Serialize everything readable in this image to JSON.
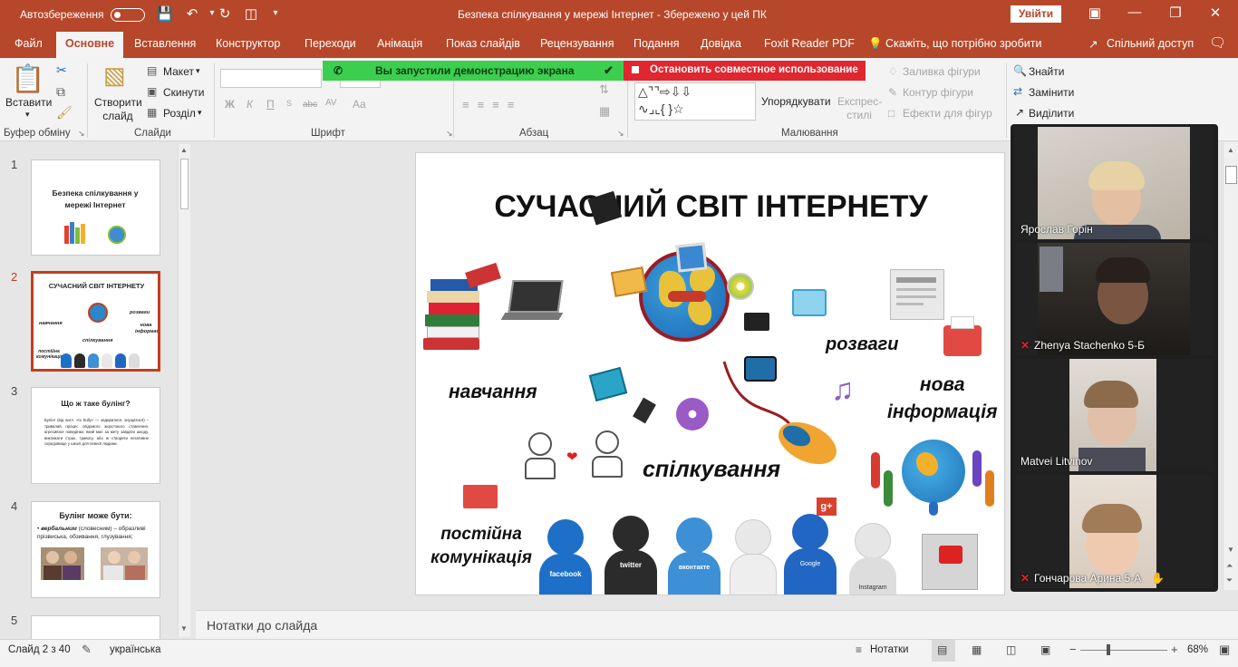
{
  "window": {
    "autosave_label": "Автозбереження",
    "autosave_state": "off",
    "doc_title": "Безпека спілкування у мережі Інтернет  -  Збережено у цей ПК",
    "signin_label": "Увійти",
    "accent_color": "#b7472a"
  },
  "tabs": [
    {
      "label": "Файл"
    },
    {
      "label": "Основне"
    },
    {
      "label": "Вставлення"
    },
    {
      "label": "Конструктор"
    },
    {
      "label": "Переходи"
    },
    {
      "label": "Анімація"
    },
    {
      "label": "Показ слайдів"
    },
    {
      "label": "Рецензування"
    },
    {
      "label": "Подання"
    },
    {
      "label": "Довідка"
    },
    {
      "label": "Foxit Reader PDF"
    },
    {
      "label": "Скажіть, що потрібно зробити"
    },
    {
      "label": "Спільний доступ"
    }
  ],
  "ribbon": {
    "clipboard": {
      "paste": "Вставити",
      "group": "Буфер обміну"
    },
    "slides": {
      "new_slide": "Створити слайд",
      "layout": "Макет",
      "reset": "Скинути",
      "section": "Розділ",
      "group": "Слайди"
    },
    "font": {
      "group": "Шрифт",
      "buttons": [
        "Ж",
        "К",
        "П",
        "abc",
        "AV",
        "Aa"
      ]
    },
    "paragraph": {
      "group": "Абзац"
    },
    "drawing": {
      "arrange": "Упорядкувати",
      "quick_styles": "Експрес-стилі",
      "fill": "Заливка фігури",
      "outline": "Контур фігури",
      "effects": "Ефекти для фігур",
      "group": "Малювання"
    },
    "editing": {
      "find": "Знайти",
      "replace": "Замінити",
      "select": "Виділити"
    }
  },
  "share_banner": {
    "active_text": "Вы запустили демонстрацию экрана",
    "stop_text": "Остановить совместное использование"
  },
  "thumbnails": [
    {
      "num": "1",
      "title": "Безпека спілкування у мережі Інтернет"
    },
    {
      "num": "2",
      "title": "СУЧАСНИЙ СВІТ ІНТЕРНЕТУ",
      "words": [
        "навчання",
        "розваги",
        "нова інформація",
        "спілкування",
        "постійна комунікація"
      ]
    },
    {
      "num": "3",
      "title": "Що ж таке булінг?",
      "body": "Булінг (від англ. «to bully» — задиратися, знущатися) – тривалий процес свідомого жорстокого ставлення, агресивної поведінки, який має за мету завдати шкоду, викликати страх, тривогу, або ж створити негативне середовище у школі для певної людини."
    },
    {
      "num": "4",
      "title": "Булінг може бути:",
      "body_lead": "вербальним",
      "body_rest": " (словесним) – образливі прізвиська, обзивання, глузування;"
    },
    {
      "num": "5"
    }
  ],
  "slide": {
    "title": "СУЧАСНИЙ СВІТ ІНТЕРНЕТУ",
    "words": {
      "learning": "навчання",
      "fun": "розваги",
      "news_l1": "нова",
      "news_l2": "інформація",
      "communication": "спілкування",
      "constant_l1": "постійна",
      "constant_l2": "комунікація"
    },
    "avatars": [
      "facebook",
      "twitter",
      "вконтакте",
      "",
      "Google",
      "Instagram"
    ],
    "brand_colors": {
      "facebook": "#1e6fc7",
      "twitter": "#2b2b2b",
      "vk": "#3d8fd6",
      "google": "#2266c4",
      "instagram": "#d9d9d9"
    }
  },
  "notes": {
    "placeholder": "Нотатки до слайда"
  },
  "status": {
    "slide_pos": "Слайд 2 з 40",
    "language": "українська",
    "notes_btn": "Нотатки",
    "zoom": "68%",
    "zoom_level": 0.68
  },
  "participants": [
    {
      "name": "Ярослав Горін",
      "muted": false
    },
    {
      "name": "Zhenya Stachenko 5-Б",
      "muted": true
    },
    {
      "name": "Matvei Litvinov",
      "muted": false
    },
    {
      "name": "Гончарова Арина 5-А",
      "muted": true
    }
  ]
}
